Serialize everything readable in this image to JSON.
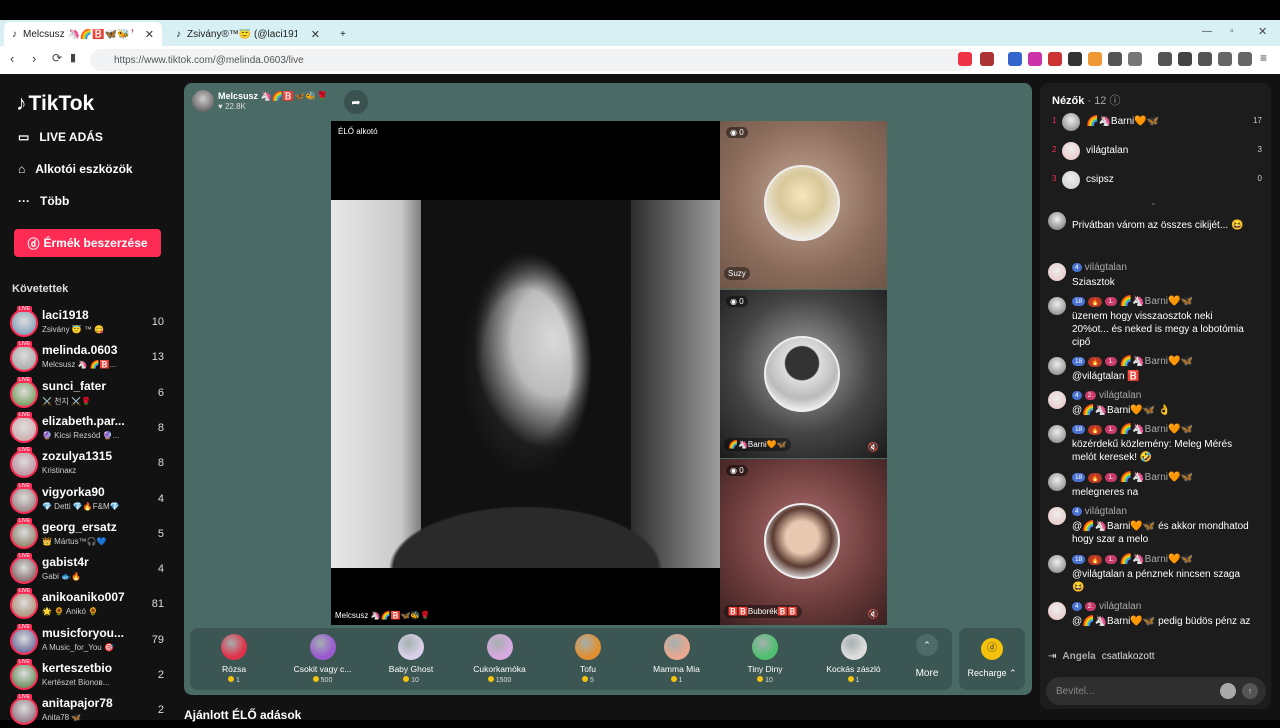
{
  "browser": {
    "tabs": [
      {
        "title": "Melcsusz 🦄🌈🅱️🦋🐝🌹 (@",
        "active": true
      },
      {
        "title": "Zsivány®™😇 (@laci1918) ÉLŐ adás",
        "active": false
      }
    ],
    "new_tab": "+",
    "url": "https://www.tiktok.com/@melinda.0603/live"
  },
  "sidebar": {
    "logo": "TikTok",
    "nav": [
      {
        "label": "LIVE ADÁS",
        "icon": "video-icon"
      },
      {
        "label": "Alkotói eszközök",
        "icon": "home-icon"
      },
      {
        "label": "Több",
        "icon": "more-icon"
      }
    ],
    "coins_button": "Érmék beszerzése",
    "following_heading": "Követettek",
    "following": [
      {
        "name": "laci1918",
        "sub": "Zsivány 😇 ™ 😋",
        "count": "10",
        "color": "#6a8fb0"
      },
      {
        "name": "melinda.0603",
        "sub": "Melcsusz 🦄 🌈🅱️...",
        "count": "13",
        "color": "#999"
      },
      {
        "name": "sunci_fater",
        "sub": "⚔️ 천지 ⚔️🌹",
        "count": "6",
        "color": "#5a8f3a"
      },
      {
        "name": "elizabeth.par...",
        "sub": "🔮 Kicsi Rezsód 🔮...",
        "count": "8",
        "color": "#c9a0a0"
      },
      {
        "name": "zozulya1315",
        "sub": "Kristinaкz",
        "count": "8",
        "color": "#b07a8a"
      },
      {
        "name": "vigyorka90",
        "sub": "💎 Detti 💎🔥F&M💎",
        "count": "4",
        "color": "#8a6a6a"
      },
      {
        "name": "georg_ersatz",
        "sub": "👑 Mártus™🎧💙",
        "count": "5",
        "color": "#7a6a4a"
      },
      {
        "name": "gabist4r",
        "sub": "Gabi 🐟🔥",
        "count": "4",
        "color": "#6a4a4a"
      },
      {
        "name": "anikoaniko007",
        "sub": "🌟 🌻 Anikó 🌻",
        "count": "81",
        "color": "#a07a5a"
      },
      {
        "name": "musicforyou...",
        "sub": "A Music_for_You 🎯",
        "count": "79",
        "color": "#4a4a8a"
      },
      {
        "name": "kerteszetbio",
        "sub": "Kertészet Bionoв...",
        "count": "2",
        "color": "#4a7a3a"
      },
      {
        "name": "anitapajor78",
        "sub": "Anita78 🦋",
        "count": "2",
        "color": "#7a5a6a"
      }
    ]
  },
  "stream": {
    "host_name": "Melcsusz 🦄🌈🅱️🦋🐝🌹",
    "host_viewers": "22.8K",
    "main_label": "ÉLŐ alkotó",
    "main_name": "Melcsusz 🦄🌈🅱️🦋🐝🌹",
    "guests": [
      {
        "score": "0",
        "name": "Suzy",
        "bg": "#8b6c5c"
      },
      {
        "score": "0",
        "name": "🌈🦄Barni🧡🦋",
        "bg": "#555"
      },
      {
        "score": "0",
        "name": "🅱️🅱️Buborék🅱️🅱️",
        "bg": "#6a3a3a"
      }
    ]
  },
  "gifts": [
    {
      "name": "Rózsa",
      "price": "1",
      "color": "#e0334a"
    },
    {
      "name": "Csokit vagy c...",
      "price": "500",
      "color": "#9a5ad0"
    },
    {
      "name": "Baby Ghost",
      "price": "10",
      "color": "#d8d0e8"
    },
    {
      "name": "Cukorkamóka",
      "price": "1500",
      "color": "#d8a8e0"
    },
    {
      "name": "Tofu",
      "price": "5",
      "color": "#e09030"
    },
    {
      "name": "Mamma Mia",
      "price": "1",
      "color": "#e8a890"
    },
    {
      "name": "Tiny Diny",
      "price": "10",
      "color": "#50c070"
    },
    {
      "name": "Kockás zászló",
      "price": "1",
      "color": "#ddd"
    }
  ],
  "gift_more": "More",
  "recharge": "Recharge",
  "recommended_heading": "Ajánlott ÉLŐ adások",
  "viewers": {
    "heading": "Nézők",
    "count": "· 12",
    "list": [
      {
        "rank": "1",
        "name": "🌈🦄Barni🧡🦋",
        "score": "17",
        "color": "#777"
      },
      {
        "rank": "2",
        "name": "világtalan",
        "score": "3",
        "color": "#e8c0c0"
      },
      {
        "rank": "3",
        "name": "csipsz",
        "score": "0",
        "color": "#ccc"
      }
    ]
  },
  "chat": {
    "messages": [
      {
        "user": "",
        "badges": [],
        "text": "Privátban várom az összes cikijét... 😆",
        "color": "#666"
      },
      {
        "user": "világtalan",
        "badges": [
          {
            "t": "4",
            "c": "b-blue"
          }
        ],
        "text": "Sziasztok",
        "color": "#e8c0c0"
      },
      {
        "user": "🌈🦄Barni🧡🦋",
        "badges": [
          {
            "t": "18",
            "c": "b-blue"
          },
          {
            "t": "🔥",
            "c": "b-or"
          },
          {
            "t": "1.",
            "c": "b-pk"
          }
        ],
        "text": "üzenem hogy visszaosztok neki 20%ot... és neked is megy a lobotómia cipő",
        "color": "#777"
      },
      {
        "user": "🌈🦄Barni🧡🦋",
        "badges": [
          {
            "t": "18",
            "c": "b-blue"
          },
          {
            "t": "🔥",
            "c": "b-or"
          },
          {
            "t": "1.",
            "c": "b-pk"
          }
        ],
        "text": "@világtalan 🅱️",
        "color": "#777"
      },
      {
        "user": "világtalan",
        "badges": [
          {
            "t": "4",
            "c": "b-blue"
          },
          {
            "t": "2.",
            "c": "b-pk"
          }
        ],
        "text": "@🌈🦄Barni🧡🦋 👌",
        "color": "#e8c0c0"
      },
      {
        "user": "🌈🦄Barni🧡🦋",
        "badges": [
          {
            "t": "18",
            "c": "b-blue"
          },
          {
            "t": "🔥",
            "c": "b-or"
          },
          {
            "t": "1.",
            "c": "b-pk"
          }
        ],
        "text": "közérdekű közlemény: Meleg Mérés melót keresek! 🤣",
        "color": "#777"
      },
      {
        "user": "🌈🦄Barni🧡🦋",
        "badges": [
          {
            "t": "18",
            "c": "b-blue"
          },
          {
            "t": "🔥",
            "c": "b-or"
          },
          {
            "t": "1.",
            "c": "b-pk"
          }
        ],
        "text": "melegneres na",
        "color": "#777"
      },
      {
        "user": "világtalan",
        "badges": [
          {
            "t": "4",
            "c": "b-blue"
          }
        ],
        "text": "@🌈🦄Barni🧡🦋 és akkor mondhatod hogy szar a melo",
        "color": "#e8c0c0"
      },
      {
        "user": "🌈🦄Barni🧡🦋",
        "badges": [
          {
            "t": "18",
            "c": "b-blue"
          },
          {
            "t": "🔥",
            "c": "b-or"
          },
          {
            "t": "1.",
            "c": "b-pk"
          }
        ],
        "text": "@világtalan a pénznek nincsen szaga😆",
        "color": "#777"
      },
      {
        "user": "világtalan",
        "badges": [
          {
            "t": "4",
            "c": "b-blue"
          },
          {
            "t": "2.",
            "c": "b-pk"
          }
        ],
        "text": "@🌈🦄Barni🧡🦋 pedig büdös pénz az",
        "color": "#e8c0c0"
      }
    ],
    "joined_user": "Angela",
    "joined_text": "csatlakozott",
    "input_placeholder": "Bevitel..."
  }
}
